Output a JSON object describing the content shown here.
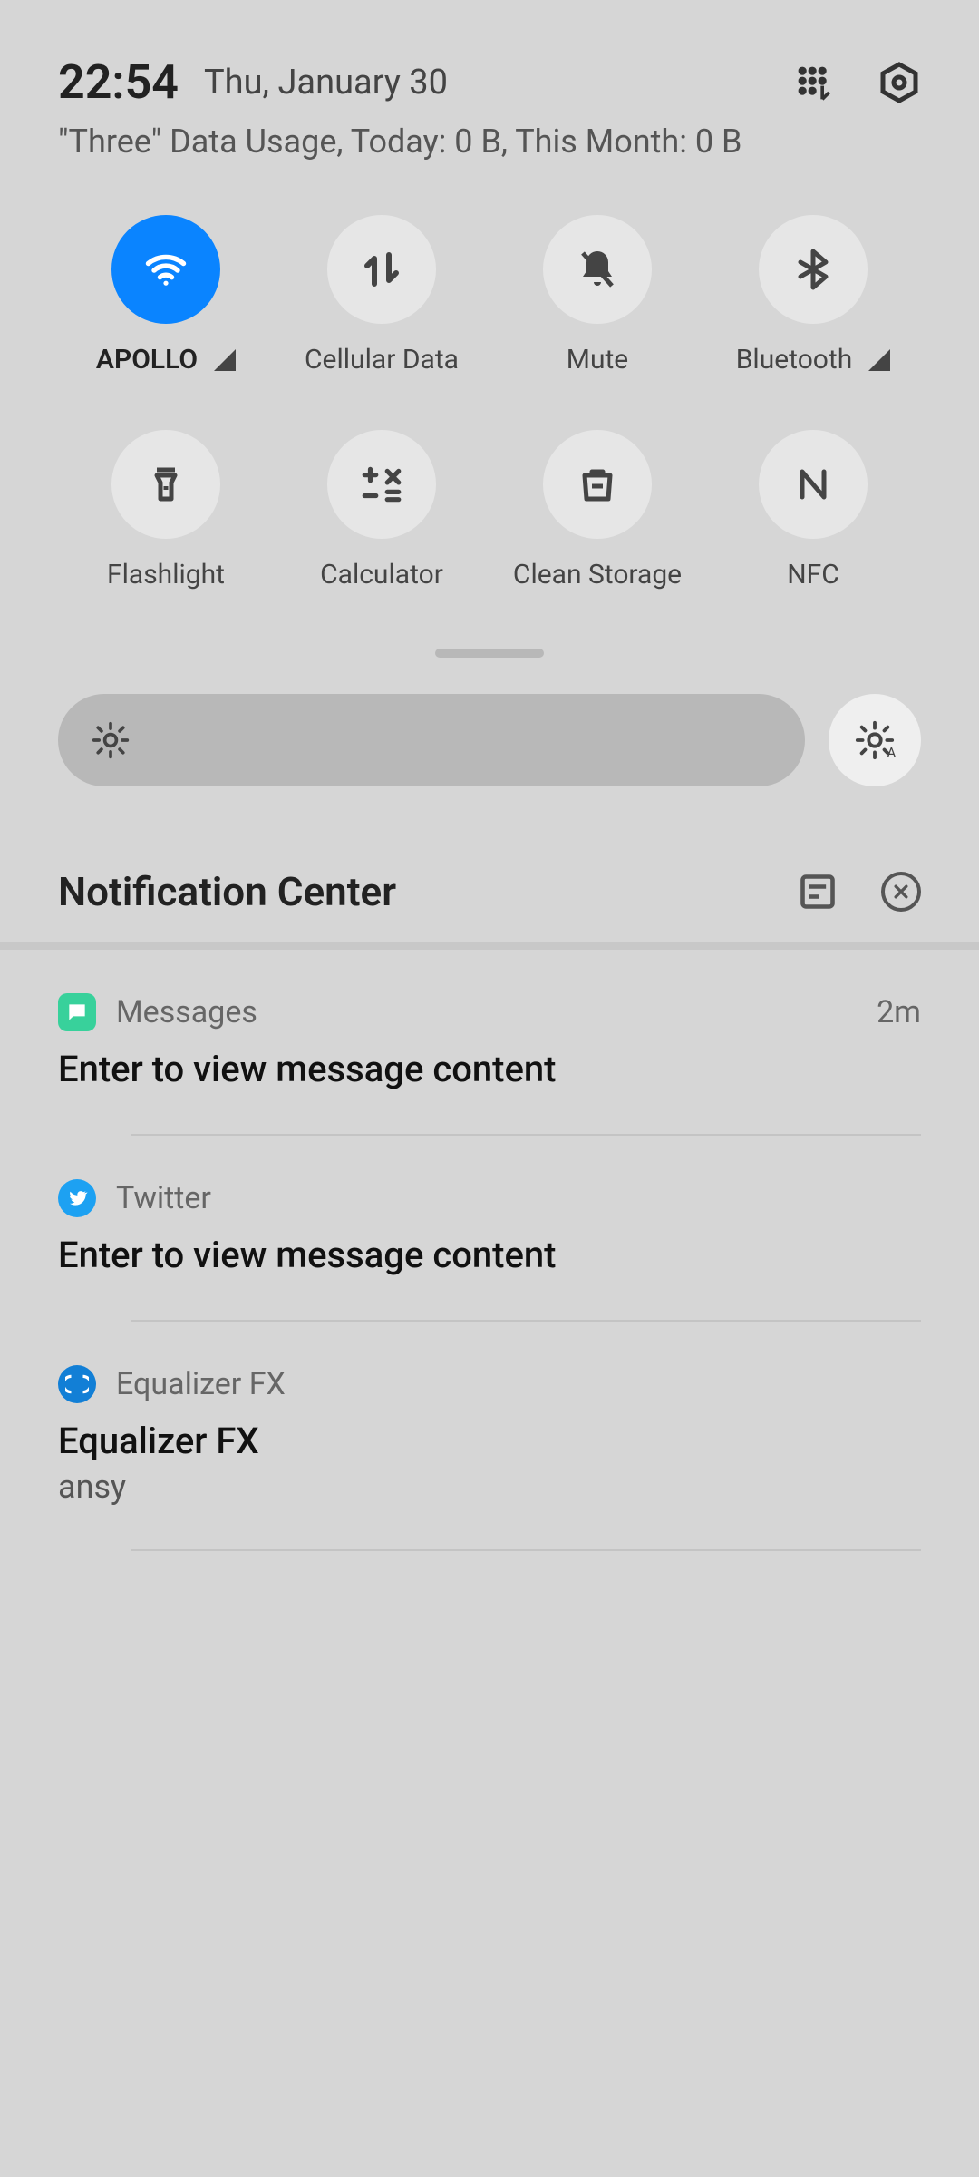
{
  "status": {
    "time": "22:54",
    "date": "Thu, January 30",
    "usage": "\"Three\" Data Usage, Today: 0 B, This Month: 0 B"
  },
  "quick_settings": {
    "wifi": {
      "label": "APOLLO",
      "on": true,
      "has_chevron": true
    },
    "cellular": {
      "label": "Cellular Data",
      "on": false
    },
    "mute": {
      "label": "Mute",
      "on": false
    },
    "bluetooth": {
      "label": "Bluetooth",
      "on": false,
      "has_chevron": true
    },
    "flashlight": {
      "label": "Flashlight",
      "on": false
    },
    "calculator": {
      "label": "Calculator",
      "on": false
    },
    "clean_storage": {
      "label": "Clean Storage",
      "on": false
    },
    "nfc": {
      "label": "NFC",
      "on": false
    }
  },
  "notification_center": {
    "title": "Notification Center"
  },
  "notifications": [
    {
      "app": "Messages",
      "time": "2m",
      "body": "Enter to view message content"
    },
    {
      "app": "Twitter",
      "time": "",
      "body": "Enter to view message content"
    },
    {
      "app": "Equalizer FX",
      "time": "",
      "body": "Equalizer FX",
      "sub": "ansy"
    }
  ]
}
